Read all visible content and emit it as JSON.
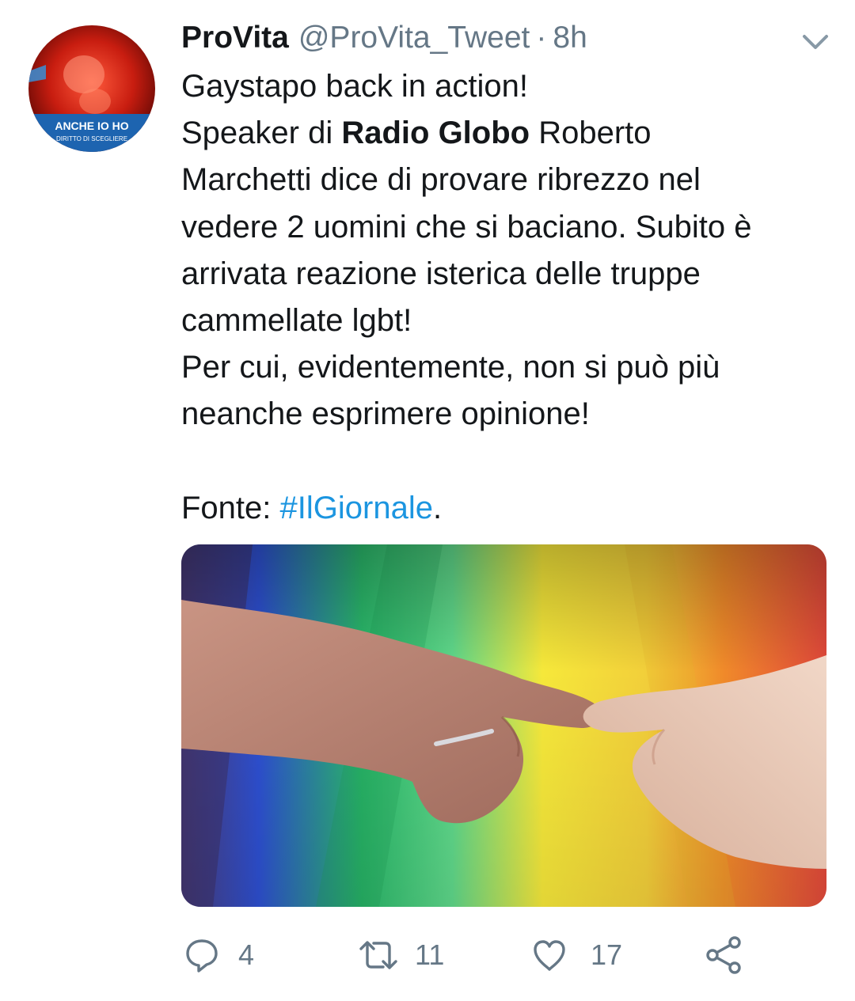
{
  "tweet": {
    "display_name": "ProVita",
    "handle": "@ProVita_Tweet",
    "separator": "·",
    "time": "8h",
    "text": {
      "line1": "Gaystapo back in action!",
      "line2_a": "Speaker di ",
      "line2_bold": "Radio Globo",
      "line2_b": " Roberto",
      "line3": "Marchetti dice di provare ribrezzo nel",
      "line4": "vedere 2 uomini che si baciano. Subito è",
      "line5": "arrivata reazione isterica delle truppe",
      "line6": "cammellate lgbt!",
      "line7": "Per cui, evidentemente, non si può più",
      "line8": "neanche esprimere opinione!",
      "source_label": "Fonte: ",
      "hashtag": "#IlGiornale",
      "source_end": "."
    }
  },
  "avatar": {
    "caption_line1": "ANCHE IO HO",
    "caption_line2": "DIRITTO DI SCEGLIERE"
  },
  "actions": {
    "reply_count": "4",
    "retweet_count": "11",
    "like_count": "17"
  },
  "icons": {
    "reply": "reply-icon",
    "retweet": "retweet-icon",
    "like": "heart-icon",
    "share": "share-icon",
    "menu": "chevron-down-icon"
  },
  "colors": {
    "text": "#14171a",
    "secondary": "#657786",
    "link": "#1b95e0"
  }
}
